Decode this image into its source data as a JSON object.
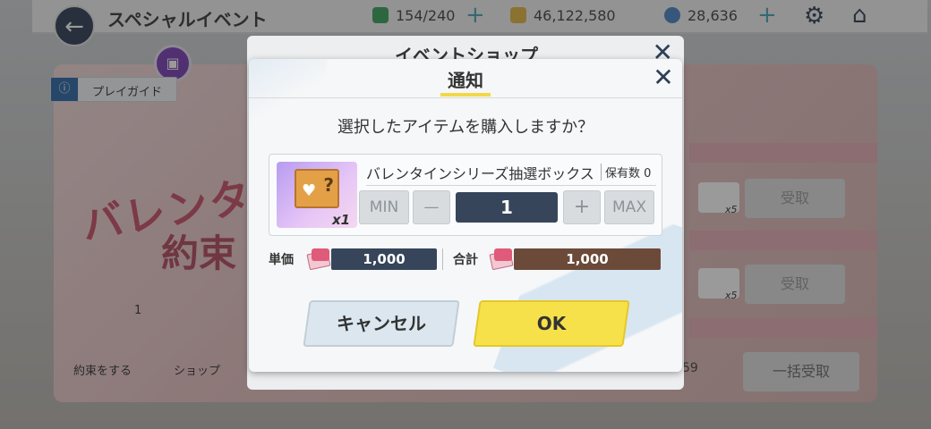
{
  "topbar": {
    "title": "スペシャルイベント",
    "stamina": "154/240",
    "coins": "46,122,580",
    "gems": "28,636"
  },
  "background": {
    "play_guide": "プレイガイド",
    "banner_title_1": "バレンタ",
    "banner_title_2": "約束",
    "promise_label": "約束をする",
    "shop_label": "ショップ",
    "promise_count": "1",
    "receive_label": "受取",
    "ticket_mult": "x5",
    "bulk_receive_label": "一括受取",
    "count_59": "59"
  },
  "shop_dialog": {
    "title": "イベントショップ"
  },
  "notice": {
    "title": "通知",
    "question": "選択したアイテムを購入しますか？",
    "item": {
      "name": "バレンタインシリーズ抽選ボックス",
      "owned": "保有数 0",
      "thumb_qty": "x1"
    },
    "quantity": {
      "min_label": "MIN",
      "minus_label": "—",
      "value": "1",
      "plus_label": "+",
      "max_label": "MAX"
    },
    "unit_price_label": "単価",
    "unit_price": "1,000",
    "total_label": "合計",
    "total_price": "1,000",
    "cancel_label": "キャンセル",
    "ok_label": "OK"
  },
  "colors": {
    "accent_yellow": "#f7e14a",
    "navy": "#37455a",
    "brown_total": "#6b4a3a"
  }
}
